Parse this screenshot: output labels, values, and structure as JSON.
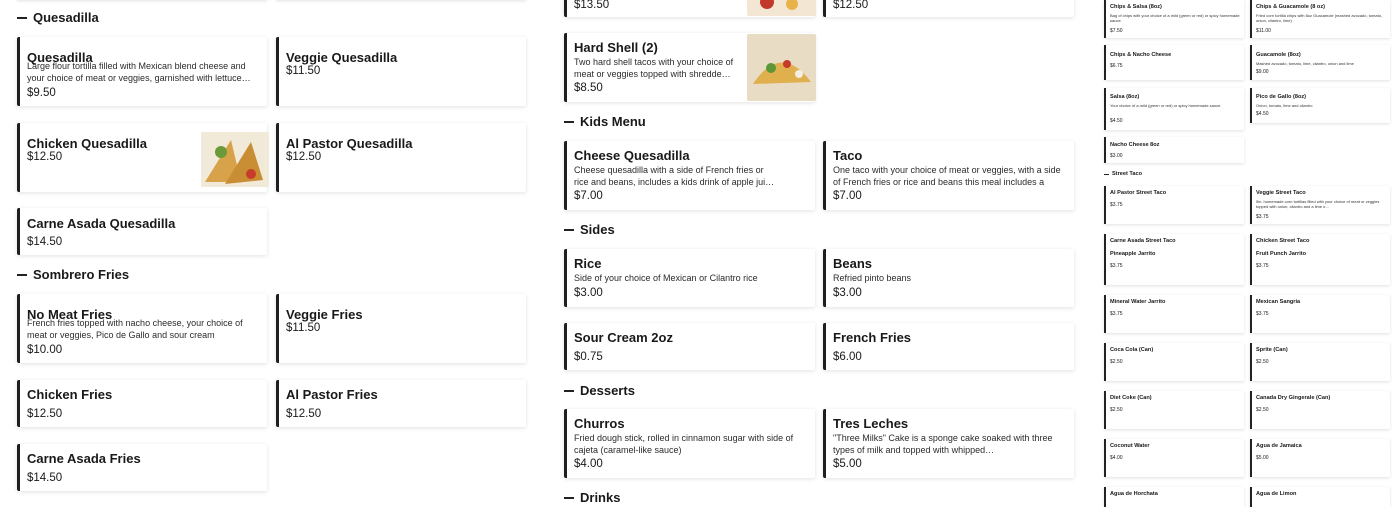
{
  "colors": {
    "accent": "#1f1f1f",
    "background": "#ffffff",
    "text": "#191919"
  },
  "col1": {
    "quesadilla_section": "Quesadilla",
    "quesadilla": {
      "name": "Quesadilla",
      "desc": "Large flour tortilla filled with Mexican blend cheese and your choice of meat or veggies, garnished with lettuce…",
      "price": "$9.50"
    },
    "veggie_quesadilla": {
      "name": "Veggie Quesadilla",
      "price": "$11.50"
    },
    "chicken_quesadilla": {
      "name": "Chicken Quesadilla",
      "price": "$12.50"
    },
    "al_pastor_quesadilla": {
      "name": "Al Pastor Quesadilla",
      "price": "$12.50"
    },
    "carne_asada_quesadilla": {
      "name": "Carne Asada Quesadilla",
      "price": "$14.50"
    },
    "sombrero_section": "Sombrero Fries",
    "no_meat_fries": {
      "name": "No Meat Fries",
      "desc": "French fries topped with nacho cheese, your choice of meat or veggies, Pico de Gallo and sour cream",
      "price": "$10.00"
    },
    "veggie_fries": {
      "name": "Veggie Fries",
      "price": "$11.50"
    },
    "chicken_fries": {
      "name": "Chicken Fries",
      "price": "$12.50"
    },
    "al_pastor_fries": {
      "name": "Al Pastor Fries",
      "price": "$12.50"
    },
    "carne_asada_fries": {
      "name": "Carne Asada Fries",
      "price": "$14.50"
    }
  },
  "col2": {
    "top_left_price": "$13.50",
    "top_right_price": "$12.50",
    "hard_shell": {
      "name": "Hard Shell (2)",
      "desc": "Two hard shell tacos with your choice of meat or veggies topped with shredde…",
      "price": "$8.50"
    },
    "kids_section": "Kids Menu",
    "cheese_quesadilla": {
      "name": "Cheese Quesadilla",
      "desc": "Cheese quesadilla with a side of French fries or rice and beans, includes a kids drink of apple jui…",
      "price": "$7.00"
    },
    "taco": {
      "name": "Taco",
      "desc": "One taco with your choice of meat or veggies, with a side of French fries or rice and beans this meal includes a kid…",
      "price": "$7.00"
    },
    "sides_section": "Sides",
    "rice": {
      "name": "Rice",
      "desc": "Side of your choice of Mexican or Cilantro rice",
      "price": "$3.00"
    },
    "beans": {
      "name": "Beans",
      "desc": "Refried pinto beans",
      "price": "$3.00"
    },
    "sour_cream": {
      "name": "Sour Cream 2oz",
      "price": "$0.75"
    },
    "french_fries": {
      "name": "French Fries",
      "price": "$6.00"
    },
    "desserts_section": "Desserts",
    "churros": {
      "name": "Churros",
      "desc": "Fried dough stick, rolled in cinnamon sugar with side of cajeta (caramel-like sauce)",
      "price": "$4.00"
    },
    "tres_leches": {
      "name": "Tres Leches",
      "desc": "\"Three Milks\" Cake is a sponge cake soaked with three types of milk and topped with whipped…",
      "price": "$5.00"
    },
    "drinks_section": "Drinks"
  },
  "col3": {
    "chips_salsa": {
      "name": "Chips & Salsa (8oz)",
      "desc": "Bag of chips with your choice of a mild (green or red) or spicy homemade sauce.",
      "price": "$7.50"
    },
    "chips_guac": {
      "name": "Chips & Guacamole (8 oz)",
      "desc": "Fried corn tortilla chips with 8oz Guacamole (mashed avocado, tomato, onion, cilantro, lime)",
      "price": "$11.00"
    },
    "chips_nacho": {
      "name": "Chips & Nacho Cheese",
      "price": "$6.75"
    },
    "guacamole": {
      "name": "Guacamole (8oz)",
      "desc": "Mashed avocado, tomato, lime, cilantro, onion and lime",
      "price": "$9.00"
    },
    "salsa": {
      "name": "Salsa (8oz)",
      "desc": "Your choice of a mild (green or red) or spicy homemade sauce.",
      "price": "$4.50"
    },
    "pico": {
      "name": "Pico de Gallo (8oz)",
      "desc": "Onion, tomato, lime and cilantro",
      "price": "$4.50"
    },
    "nacho_cheese": {
      "name": "Nacho Cheese 8oz",
      "price": "$3.00"
    },
    "street_taco_section": "Street Taco",
    "al_pastor_street": {
      "name": "Al Pastor Street Taco",
      "price": "$3.75"
    },
    "veggie_street": {
      "name": "Veggie Street Taco",
      "desc": "5in. homemade corn tortillas filled with your choice of meat or veggies topped with onion, cilantro and a lime o…",
      "price": "$3.75"
    },
    "carne_asada_street": {
      "name": "Carne Asada Street Taco",
      "price": ""
    },
    "chicken_street": {
      "name": "Chicken Street Taco",
      "price": ""
    },
    "pineapple": {
      "name": "Pineapple Jarrito",
      "price": "$3.75"
    },
    "fruit_punch": {
      "name": "Fruit Punch Jarrito",
      "price": "$3.75"
    },
    "mineral_water": {
      "name": "Mineral Water Jarrito",
      "price": "$3.75"
    },
    "sangria": {
      "name": "Mexican Sangria",
      "price": "$3.75"
    },
    "coca_cola": {
      "name": "Coca Cola (Can)",
      "price": "$2.50"
    },
    "sprite": {
      "name": "Sprite (Can)",
      "price": "$2.50"
    },
    "diet_coke": {
      "name": "Diet Coke (Can)",
      "price": "$2.50"
    },
    "ginger_ale": {
      "name": "Canada Dry Gingerale (Can)",
      "price": "$2.50"
    },
    "coconut_water": {
      "name": "Coconut Water",
      "price": "$4.00"
    },
    "jamaica": {
      "name": "Agua de Jamaica",
      "price": "$5.00"
    },
    "horchata": {
      "name": "Agua de Horchata"
    },
    "limon": {
      "name": "Agua de Limon"
    }
  }
}
